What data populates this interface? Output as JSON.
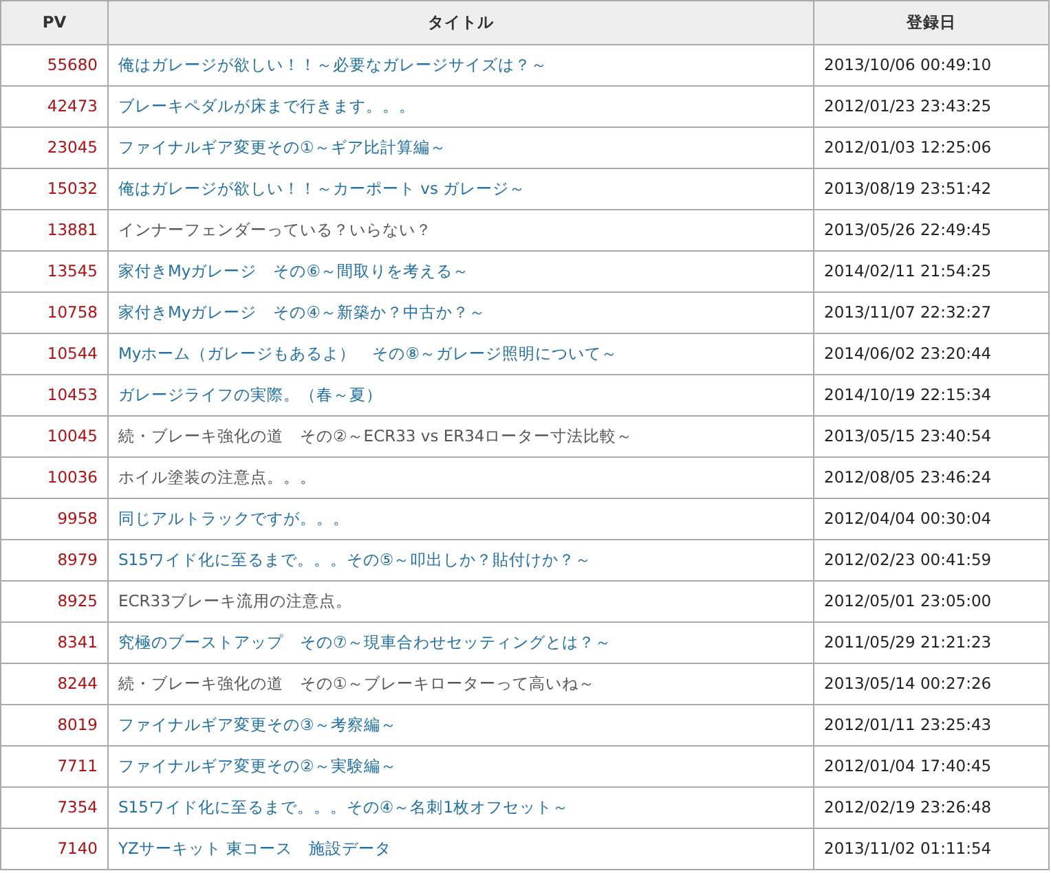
{
  "table": {
    "columns": [
      "PV",
      "タイトル",
      "登録日"
    ],
    "rows": [
      {
        "pv": "55680",
        "title": "俺はガレージが欲しい！！～必要なガレージサイズは？～",
        "visited": false,
        "date": "2013/10/06 00:49:10"
      },
      {
        "pv": "42473",
        "title": "ブレーキペダルが床まで行きます。。。",
        "visited": false,
        "date": "2012/01/23 23:43:25"
      },
      {
        "pv": "23045",
        "title": "ファイナルギア変更その①～ギア比計算編～",
        "visited": false,
        "date": "2012/01/03 12:25:06"
      },
      {
        "pv": "15032",
        "title": "俺はガレージが欲しい！！～カーポート vs ガレージ～",
        "visited": false,
        "date": "2013/08/19 23:51:42"
      },
      {
        "pv": "13881",
        "title": "インナーフェンダーっている？いらない？",
        "visited": true,
        "date": "2013/05/26 22:49:45"
      },
      {
        "pv": "13545",
        "title": "家付きMyガレージ　その⑥～間取りを考える～",
        "visited": false,
        "date": "2014/02/11 21:54:25"
      },
      {
        "pv": "10758",
        "title": "家付きMyガレージ　その④～新築か？中古か？～",
        "visited": false,
        "date": "2013/11/07 22:32:27"
      },
      {
        "pv": "10544",
        "title": "Myホーム（ガレージもあるよ）　その⑧～ガレージ照明について～",
        "visited": false,
        "date": "2014/06/02 23:20:44"
      },
      {
        "pv": "10453",
        "title": "ガレージライフの実際。（春～夏）",
        "visited": false,
        "date": "2014/10/19 22:15:34"
      },
      {
        "pv": "10045",
        "title": "続・ブレーキ強化の道　その②～ECR33 vs ER34ローター寸法比較～",
        "visited": true,
        "date": "2013/05/15 23:40:54"
      },
      {
        "pv": "10036",
        "title": "ホイル塗装の注意点。。。",
        "visited": true,
        "date": "2012/08/05 23:46:24"
      },
      {
        "pv": "9958",
        "title": "同じアルトラックですが。。。",
        "visited": false,
        "date": "2012/04/04 00:30:04"
      },
      {
        "pv": "8979",
        "title": "S15ワイド化に至るまで。。。その⑤～叩出しか？貼付けか？～",
        "visited": false,
        "date": "2012/02/23 00:41:59"
      },
      {
        "pv": "8925",
        "title": "ECR33ブレーキ流用の注意点。",
        "visited": true,
        "date": "2012/05/01 23:05:00"
      },
      {
        "pv": "8341",
        "title": "究極のブーストアップ　その⑦～現車合わせセッティングとは？～",
        "visited": false,
        "date": "2011/05/29 21:21:23"
      },
      {
        "pv": "8244",
        "title": "続・ブレーキ強化の道　その①～ブレーキローターって高いね～",
        "visited": true,
        "date": "2013/05/14 00:27:26"
      },
      {
        "pv": "8019",
        "title": "ファイナルギア変更その③～考察編～",
        "visited": false,
        "date": "2012/01/11 23:25:43"
      },
      {
        "pv": "7711",
        "title": "ファイナルギア変更その②～実験編～",
        "visited": false,
        "date": "2012/01/04 17:40:45"
      },
      {
        "pv": "7354",
        "title": "S15ワイド化に至るまで。。。その④～名刺1枚オフセット～",
        "visited": false,
        "date": "2012/02/19 23:26:48"
      },
      {
        "pv": "7140",
        "title": "YZサーキット 東コース　施設データ",
        "visited": false,
        "date": "2013/11/02 01:11:54"
      }
    ]
  }
}
